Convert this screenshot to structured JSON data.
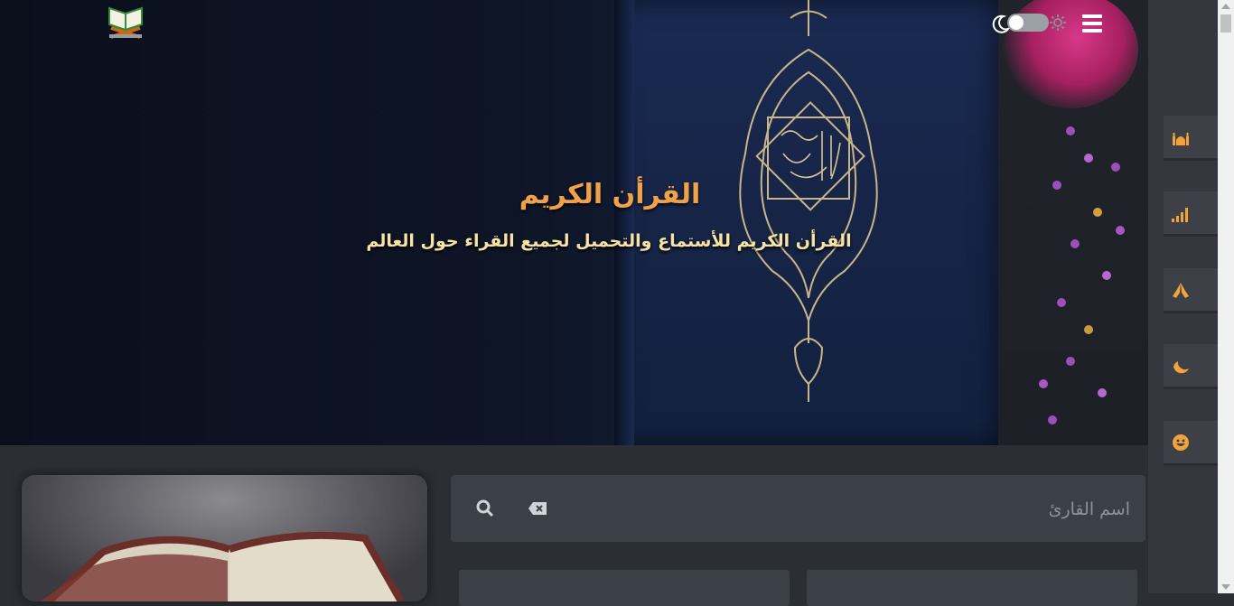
{
  "header": {
    "logo_icon": "quran-book-icon",
    "theme_toggle": {
      "dark_icon": "moon-icon",
      "light_icon": "sun-icon",
      "state": "dark"
    },
    "menu_icon": "hamburger-menu-icon"
  },
  "hero": {
    "title": "القرأن الكريم",
    "subtitle": "القرأن الكريم للأستماع والتحميل لجميع القراء حول العالم"
  },
  "rail": {
    "items": [
      {
        "icon": "mosque-icon"
      },
      {
        "icon": "signal-bars-icon"
      },
      {
        "icon": "praying-hands-icon"
      },
      {
        "icon": "crescent-moon-icon"
      },
      {
        "icon": "smile-icon"
      }
    ],
    "accent": "#f2a33a"
  },
  "search": {
    "placeholder": "اسم القارئ",
    "value": "",
    "search_icon": "search-icon",
    "clear_icon": "backspace-icon"
  },
  "colors": {
    "background": "#2b2e33",
    "panel": "#3b3f47",
    "title": "#f0a24a",
    "subtitle": "#f7e3a6"
  }
}
